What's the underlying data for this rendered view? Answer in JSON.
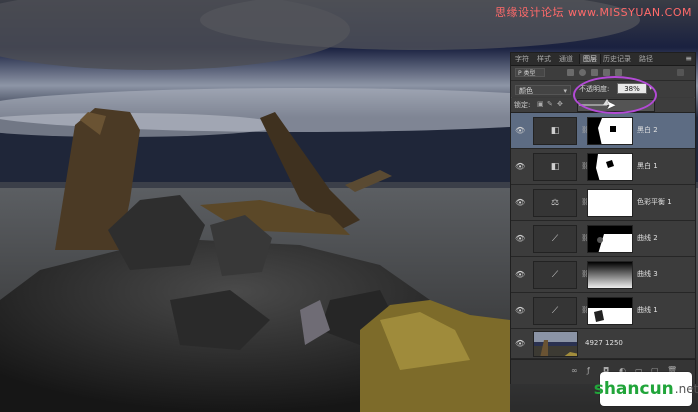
{
  "watermark": {
    "top_text": "思缘设计论坛  www.MISSYUAN.COM",
    "logo_text": "shancun",
    "logo_suffix": ".net"
  },
  "panel": {
    "tabs": [
      "字符",
      "样式",
      "通道",
      "图层",
      "历史记录",
      "路径"
    ],
    "active_tab_index": 3,
    "filter_kind": "P 类型",
    "blend_mode": "颜色",
    "opacity_label": "不透明度:",
    "opacity_value": "38%",
    "opacity_fraction": 0.38,
    "lock_label": "锁定:",
    "layers": [
      {
        "name": "黑白 2",
        "adj_icon": "bw-adjustment-icon",
        "selected": true
      },
      {
        "name": "黑白 1",
        "adj_icon": "bw-adjustment-icon",
        "selected": false
      },
      {
        "name": "色彩平衡 1",
        "adj_icon": "color-balance-icon",
        "selected": false
      },
      {
        "name": "曲线 2",
        "adj_icon": "curves-icon",
        "selected": false
      },
      {
        "name": "曲线 3",
        "adj_icon": "curves-icon",
        "selected": false
      },
      {
        "name": "曲线 1",
        "adj_icon": "curves-icon",
        "selected": false
      }
    ],
    "background_layer_name": "4927 1250"
  },
  "colors": {
    "selection": "#5d6c83",
    "highlight_ring": "#b34ad6",
    "watermark_green": "#21a53a",
    "watermark_red": "#ff6a6a"
  }
}
